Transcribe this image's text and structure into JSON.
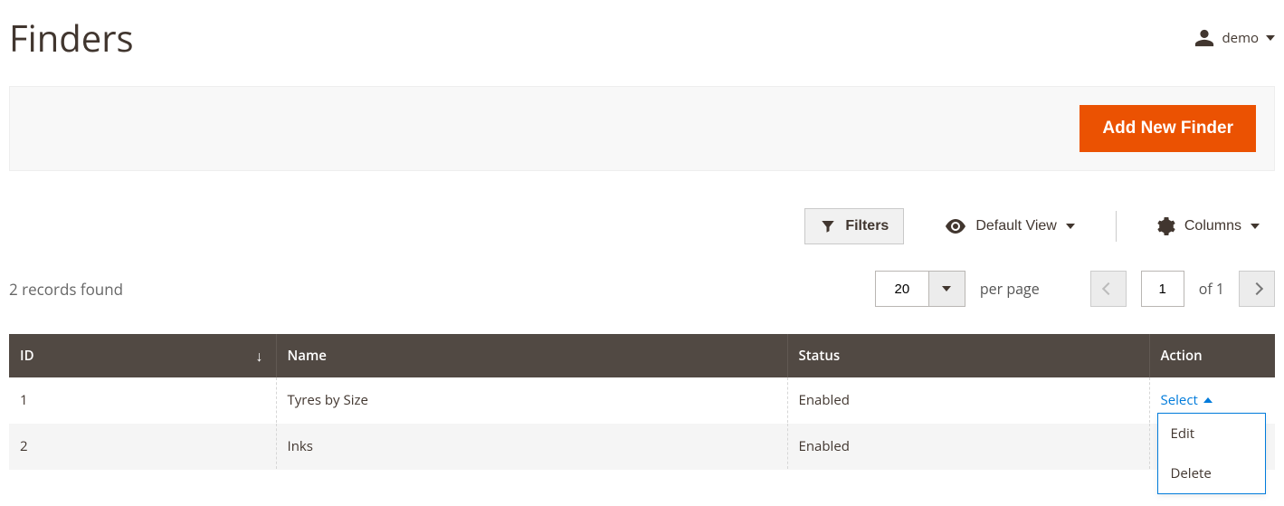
{
  "header": {
    "title": "Finders",
    "user_label": "demo"
  },
  "action_bar": {
    "add_button_label": "Add New Finder"
  },
  "toolbar": {
    "filters_label": "Filters",
    "view_label": "Default View",
    "columns_label": "Columns"
  },
  "pager": {
    "records_found_text": "2 records found",
    "per_page_value": "20",
    "per_page_label": "per page",
    "current_page": "1",
    "of_label": "of 1"
  },
  "grid": {
    "columns": {
      "id": "ID",
      "name": "Name",
      "status": "Status",
      "action": "Action"
    },
    "sort_indicator": "↓",
    "action_trigger_label": "Select",
    "action_menu": {
      "edit": "Edit",
      "delete": "Delete"
    },
    "rows": [
      {
        "id": "1",
        "name": "Tyres by Size",
        "status": "Enabled"
      },
      {
        "id": "2",
        "name": "Inks",
        "status": "Enabled"
      }
    ]
  }
}
